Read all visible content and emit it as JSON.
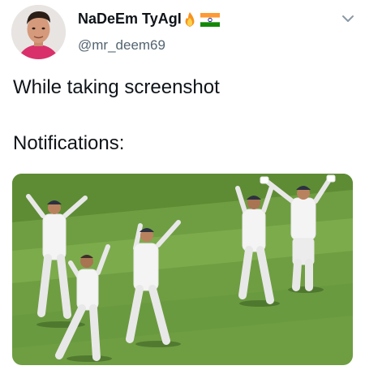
{
  "author": {
    "display_name": "NaDeEm TyAgI",
    "handle": "@mr_deem69",
    "emojis": [
      "fire-emoji",
      "india-flag-emoji"
    ]
  },
  "tweet": {
    "lines": [
      "While taking screenshot",
      "Notifications:"
    ]
  },
  "media": {
    "description_icon": "photo",
    "colors": {
      "grass_light": "#7aa84a",
      "grass_dark": "#5f8f36",
      "kit": "#f4f4f4",
      "cap": "#2c3140"
    }
  },
  "menu": {
    "icon": "chevron-down-icon"
  }
}
